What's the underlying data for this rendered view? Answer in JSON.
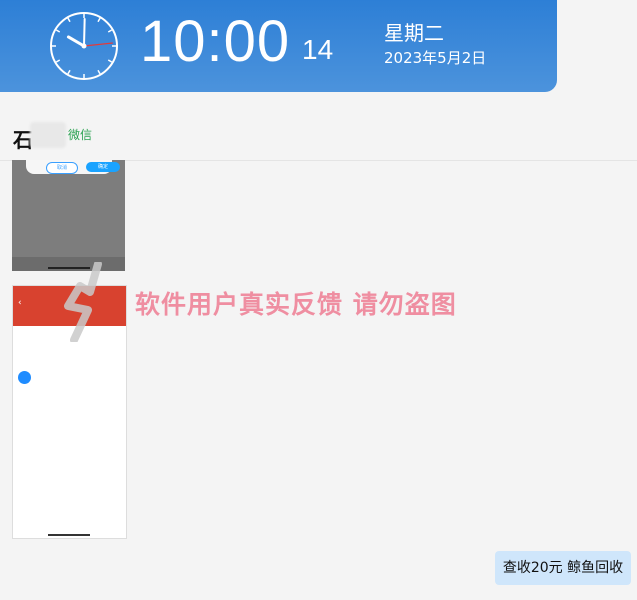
{
  "banner": {
    "time": "10:00",
    "seconds": "14",
    "weekday": "星期二",
    "date": "2023年5月2日",
    "clock": {
      "hour": 10,
      "minute": 0,
      "second": 14
    }
  },
  "chat": {
    "contact_name": "石",
    "source": "微信"
  },
  "screenshot1": {
    "cancel": "取消",
    "confirm": "确定"
  },
  "screenshot2": {
    "back_icon": "chevron-left-icon"
  },
  "watermark": "软件用户真实反馈  请勿盗图",
  "action": {
    "label": "查收20元 鲸鱼回收"
  },
  "colors": {
    "banner": "#3a88d9",
    "watermark": "#ef8ea1",
    "pill": "#cfe6fb",
    "source": "#2aa251"
  }
}
